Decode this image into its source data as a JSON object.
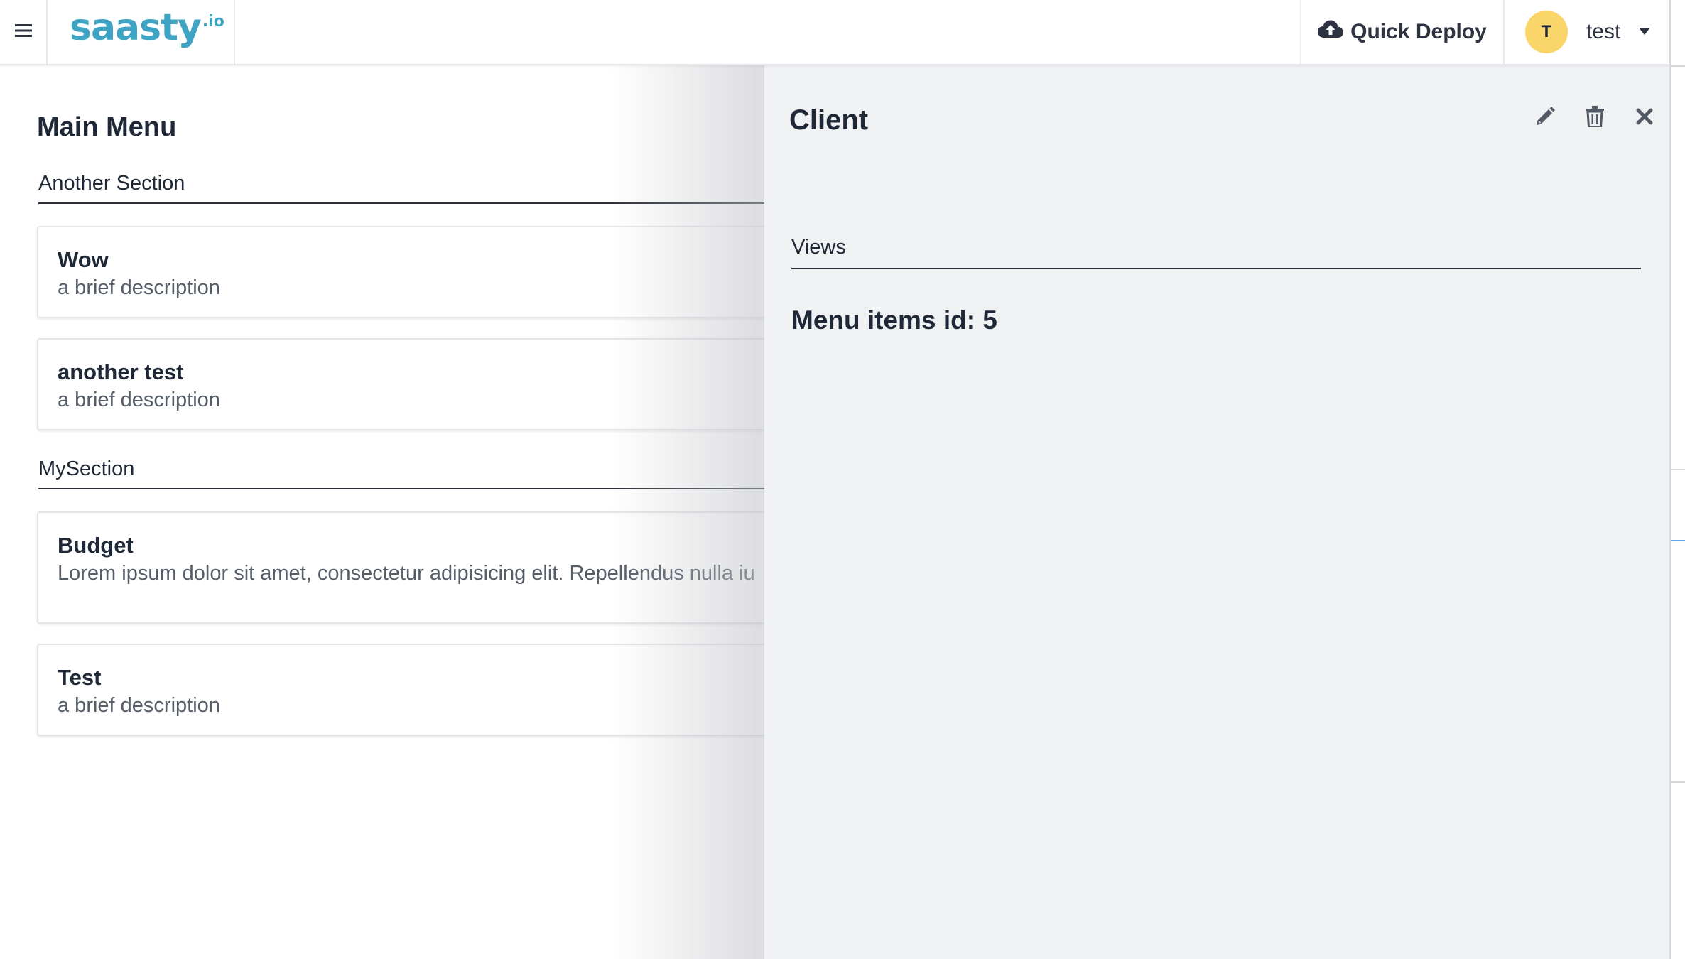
{
  "header": {
    "logo_text": "saasty",
    "logo_suffix": ".io",
    "quick_deploy_label": "Quick Deploy",
    "user": {
      "initial": "T",
      "name": "test"
    }
  },
  "main": {
    "title": "Main Menu",
    "sections": [
      {
        "heading": "Another Section",
        "items": [
          {
            "title": "Wow",
            "description": "a brief description"
          },
          {
            "title": "another test",
            "description": "a brief description"
          }
        ]
      },
      {
        "heading": "MySection",
        "items": [
          {
            "title": "Budget",
            "description": "Lorem ipsum dolor sit amet, consectetur adipisicing elit. Repellendus nulla iu"
          },
          {
            "title": "Test",
            "description": "a brief description"
          }
        ]
      }
    ]
  },
  "panel": {
    "title": "Client",
    "views_heading": "Views",
    "menu_items_text": "Menu items id: 5"
  },
  "icons": {
    "menu": "hamburger-icon",
    "deploy": "cloud-upload-icon",
    "dropdown": "caret-down-icon",
    "edit": "pencil-icon",
    "delete": "trash-icon",
    "close": "close-icon"
  },
  "colors": {
    "brand": "#3fa4c4",
    "avatar": "#fad56a",
    "panel_bg": "#f0f1f3",
    "text": "#1f2836"
  }
}
